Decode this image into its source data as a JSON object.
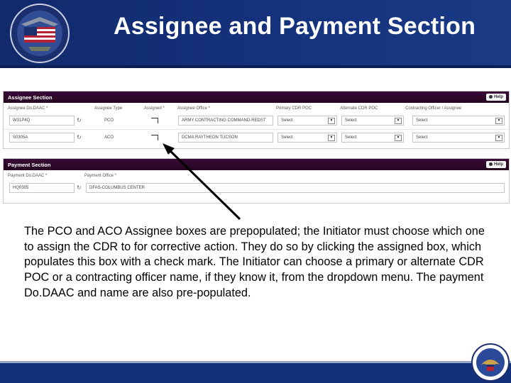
{
  "slide": {
    "title": "Assignee and Payment Section",
    "body": "The PCO and ACO Assignee boxes are prepopulated; the Initiator must choose which one to assign the CDR to for corrective action.  They do so by clicking the assigned box, which populates this box with a check mark.  The Initiator can choose a primary or alternate CDR POC or a contracting officer name, if they know it, from the dropdown menu.   The payment Do.DAAC and name are also pre-populated."
  },
  "colors": {
    "banner": "#14307a",
    "panel_header": "#2b0727",
    "arrow": "#000000"
  },
  "assignee_section": {
    "title": "Assignee Section",
    "help_label": "Help",
    "columns": {
      "dodaac": "Assignee Do.DAAC *",
      "type": "Assignee Type",
      "assigned": "Assigned *",
      "office": "Assignee Office *",
      "primary_poc": "Primary CDR POC",
      "alternate_poc": "Alternate CDR POC",
      "contracting_officer": "Contracting Officer / Assignee"
    },
    "rows": [
      {
        "dodaac": "W31P4Q",
        "type": "PCO",
        "office": "ARMY CONTRACTING COMMAND-REDST",
        "primary_poc": "Select",
        "alternate_poc": "Select",
        "contracting_officer": "Select"
      },
      {
        "dodaac": "S0305A",
        "type": "ACO",
        "office": "DCMA RAYTHEON TUCSON",
        "primary_poc": "Select",
        "alternate_poc": "Select",
        "contracting_officer": "Select"
      }
    ]
  },
  "payment_section": {
    "title": "Payment Section",
    "help_label": "Help",
    "columns": {
      "dodaac": "Payment Do.DAAC *",
      "office": "Payment Office *"
    },
    "row": {
      "dodaac": "HQ0305",
      "office": "DFAS-COLUMBUS CENTER"
    }
  },
  "icons": {
    "seal": "army-contracting-seal-icon",
    "dod_seal": "dod-seal-icon",
    "refresh": "refresh-icon",
    "dropdown": "chevron-down-icon",
    "help": "help-icon"
  }
}
